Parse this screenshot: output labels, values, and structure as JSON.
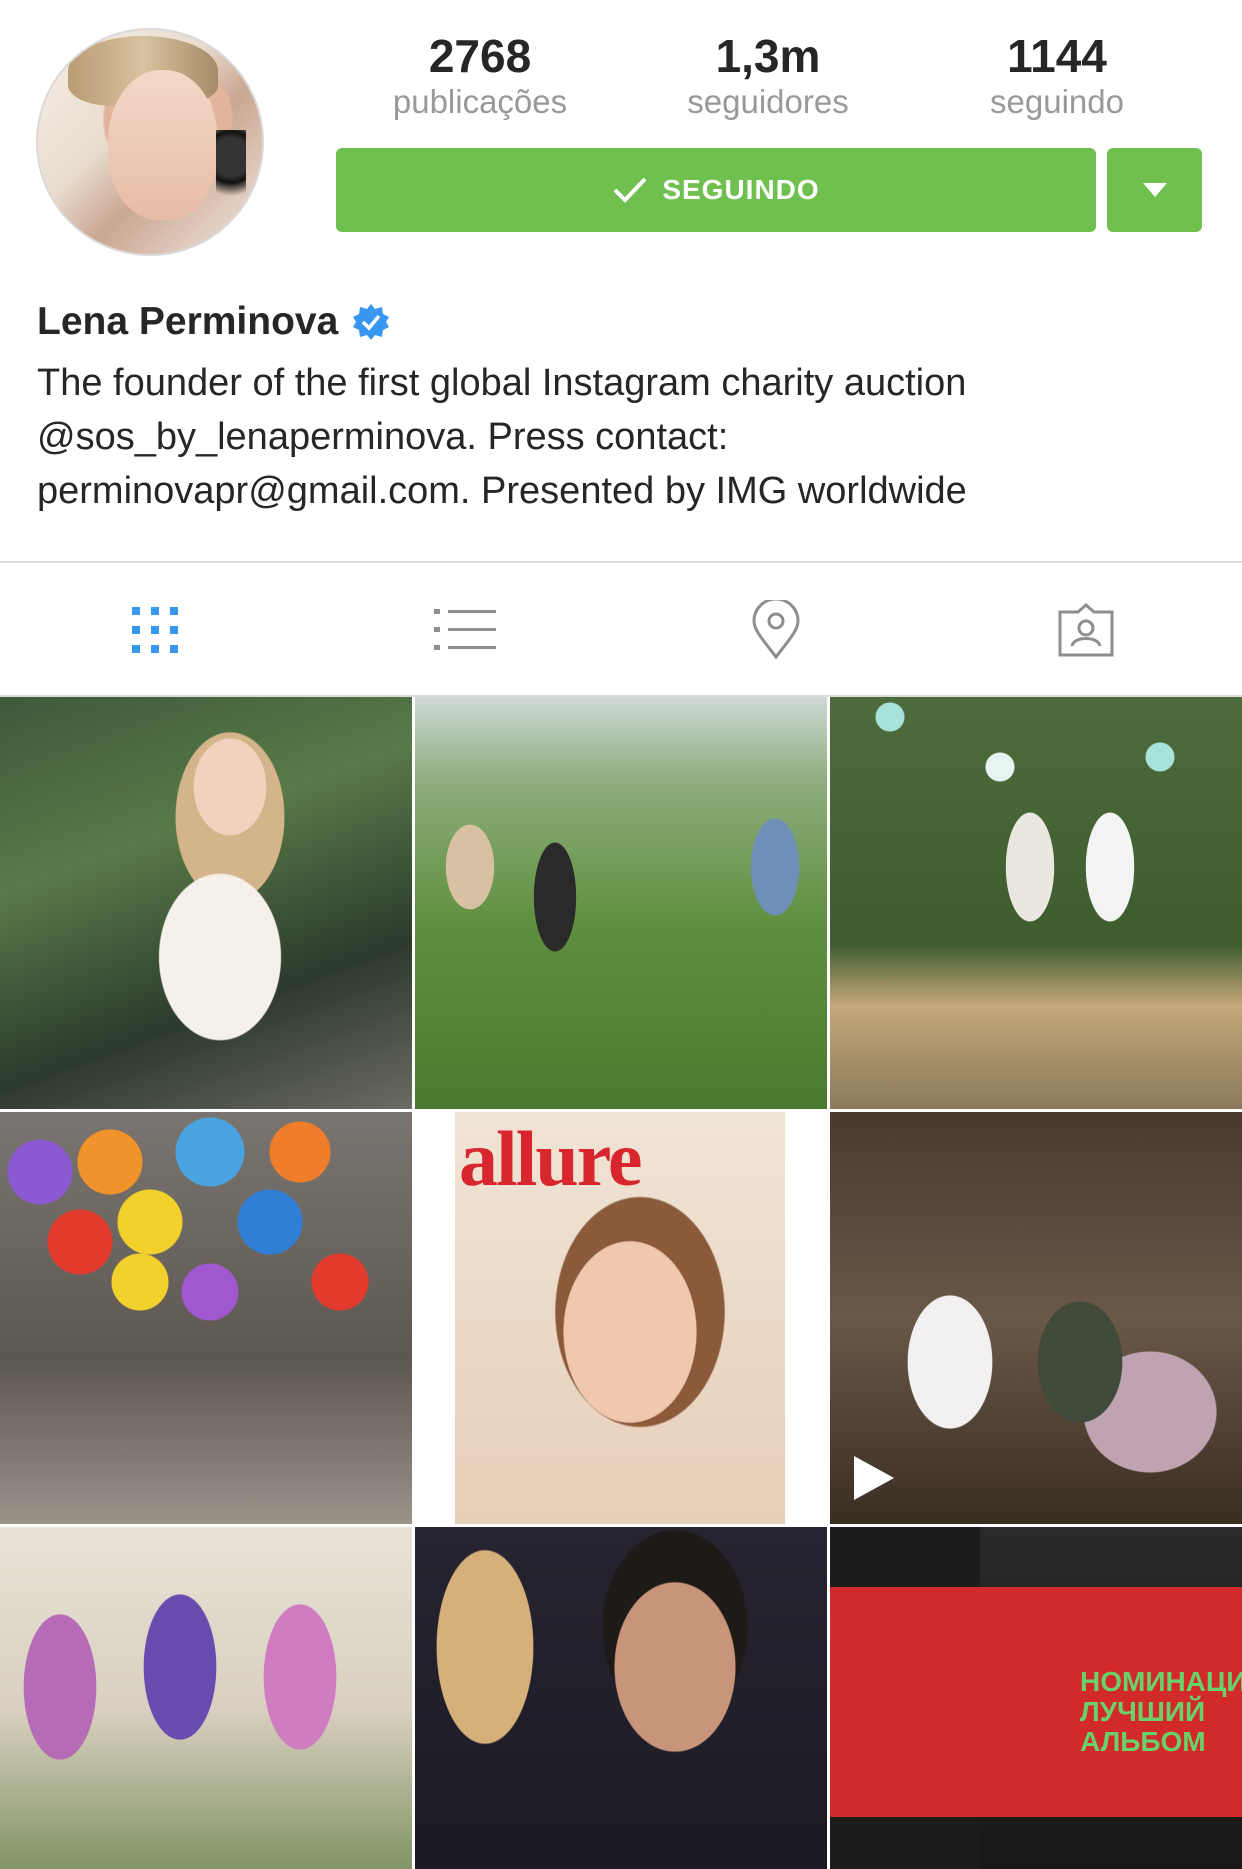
{
  "profile": {
    "name": "Lena Perminova",
    "verified": true,
    "bio_lines": [
      "The founder of the first global Instagram charity auction",
      "@sos_by_lenaperminova. Press contact:",
      "perminovapr@gmail.com. Presented by IMG worldwide"
    ]
  },
  "stats": [
    {
      "value": "2768",
      "label": "publicações"
    },
    {
      "value": "1,3m",
      "label": "seguidores"
    },
    {
      "value": "1144",
      "label": "seguindo"
    }
  ],
  "actions": {
    "follow_label": "SEGUINDO",
    "accent_color": "#6fc04f"
  },
  "tabs": [
    {
      "icon": "grid-icon",
      "active": true
    },
    {
      "icon": "list-icon",
      "active": false
    },
    {
      "icon": "location-pin-icon",
      "active": false
    },
    {
      "icon": "tagged-photos-icon",
      "active": false
    }
  ],
  "grid": {
    "posts": [
      {
        "content": "photo",
        "video": false
      },
      {
        "content": "photo",
        "video": false
      },
      {
        "content": "photo",
        "video": false
      },
      {
        "content": "photo",
        "video": false
      },
      {
        "content": "magazine cover",
        "video": false,
        "cover_text": "allure"
      },
      {
        "content": "photo",
        "video": true
      },
      {
        "content": "photo",
        "video": false
      },
      {
        "content": "photo",
        "video": false
      },
      {
        "content": "photo",
        "video": false,
        "stage_text": "НОМИНАЦИЯ ЛУЧШИЙ АЛЬБОМ"
      }
    ]
  }
}
